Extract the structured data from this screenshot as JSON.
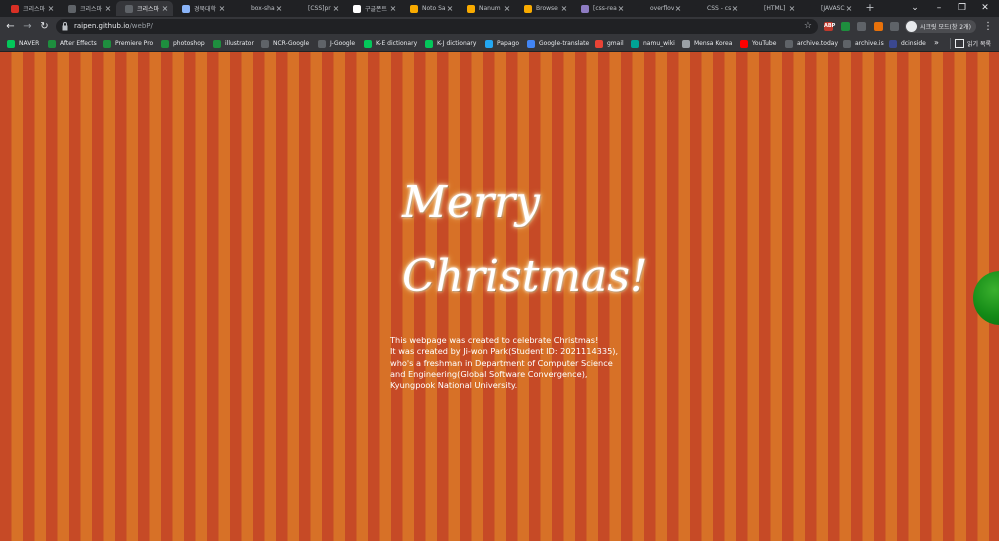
{
  "browser": {
    "tabs": [
      {
        "label": "크리스마",
        "icon": "user-icon",
        "icon_color": "#d93025"
      },
      {
        "label": "크리스마",
        "icon": "globe-icon",
        "icon_color": "#5f6368"
      },
      {
        "label": "크리스마",
        "icon": "globe-icon",
        "icon_color": "#5f6368",
        "active": true
      },
      {
        "label": "경북대학",
        "icon": "app-icon",
        "icon_color": "#8ab4f8"
      },
      {
        "label": "box-sha",
        "icon": "github-icon",
        "icon_color": "#202124"
      },
      {
        "label": "[CSS]pr",
        "icon": "t-icon",
        "icon_color": "#202124"
      },
      {
        "label": "구글폰트",
        "icon": "google-icon",
        "icon_color": "#ffffff"
      },
      {
        "label": "Noto Sa",
        "icon": "font-icon",
        "icon_color": "#f9ab00"
      },
      {
        "label": "Nanum",
        "icon": "font-icon",
        "icon_color": "#f9ab00"
      },
      {
        "label": "Browse",
        "icon": "font-icon",
        "icon_color": "#f9ab00"
      },
      {
        "label": "[css-real",
        "icon": "chat-icon",
        "icon_color": "#8e7cc3"
      },
      {
        "label": "overflov",
        "icon": "github-icon",
        "icon_color": "#202124"
      },
      {
        "label": "CSS - cs",
        "icon": "t-icon",
        "icon_color": "#202124"
      },
      {
        "label": "[HTML]",
        "icon": "t-icon",
        "icon_color": "#202124"
      },
      {
        "label": "[JAVASC",
        "icon": "t-icon",
        "icon_color": "#202124"
      }
    ],
    "address": {
      "host": "raipen.github.io",
      "path": "/webP/"
    },
    "profile_label": "시크릿 모드(창 2개)",
    "extensions": [
      {
        "name": "abp-icon",
        "label": "ABP",
        "color": "#c0392b"
      },
      {
        "name": "sheet-icon",
        "label": "",
        "color": "#1e8e3e"
      },
      {
        "name": "sync-icon",
        "label": "",
        "color": "#5f6368"
      },
      {
        "name": "ext-orange-icon",
        "label": "",
        "color": "#e8710a"
      },
      {
        "name": "puzzle-icon",
        "label": "",
        "color": "#5f6368"
      }
    ],
    "bookmarks": [
      {
        "label": "NAVER",
        "icon": "naver-icon",
        "color": "#03c75a"
      },
      {
        "label": "After Effects",
        "icon": "folder-icon",
        "color": "#1e8e3e"
      },
      {
        "label": "Premiere Pro",
        "icon": "folder-icon",
        "color": "#1e8e3e"
      },
      {
        "label": "photoshop",
        "icon": "folder-icon",
        "color": "#1e8e3e"
      },
      {
        "label": "illustrator",
        "icon": "folder-icon",
        "color": "#1e8e3e"
      },
      {
        "label": "NCR-Google",
        "icon": "globe-icon",
        "color": "#5f6368"
      },
      {
        "label": "J-Google",
        "icon": "globe-icon",
        "color": "#5f6368"
      },
      {
        "label": "K-E dictionary",
        "icon": "naver-icon",
        "color": "#03c75a"
      },
      {
        "label": "K-J dictionary",
        "icon": "naver-icon",
        "color": "#03c75a"
      },
      {
        "label": "Papago",
        "icon": "papago-icon",
        "color": "#23a7f2"
      },
      {
        "label": "Google-translate",
        "icon": "translate-icon",
        "color": "#4285f4"
      },
      {
        "label": "gmail",
        "icon": "gmail-icon",
        "color": "#ea4335"
      },
      {
        "label": "namu_wiki",
        "icon": "wiki-icon",
        "color": "#00a495"
      },
      {
        "label": "Mensa Korea",
        "icon": "mensa-icon",
        "color": "#9aa0a6"
      },
      {
        "label": "YouTube",
        "icon": "youtube-icon",
        "color": "#ff0000"
      },
      {
        "label": "archive.today",
        "icon": "globe-icon",
        "color": "#5f6368"
      },
      {
        "label": "archive.is",
        "icon": "globe-icon",
        "color": "#5f6368"
      },
      {
        "label": "dcinside",
        "icon": "dc-icon",
        "color": "#3b4890"
      }
    ],
    "bookmarks_more": "»",
    "reading_list": "읽기 목록"
  },
  "page": {
    "title_line1": "Merry",
    "title_line2": "Christmas!",
    "description": [
      "This webpage was created to celebrate Christmas!",
      "It was created by Ji-won Park(Student ID: 2021114335),",
      "who's a freshman in Department of Computer Science",
      "and Engineering(Global Software Convergence),",
      "Kyungpook National University."
    ],
    "stripe_colors": [
      "#c64a26",
      "#d77127"
    ],
    "ornament_color": "#138a16"
  }
}
